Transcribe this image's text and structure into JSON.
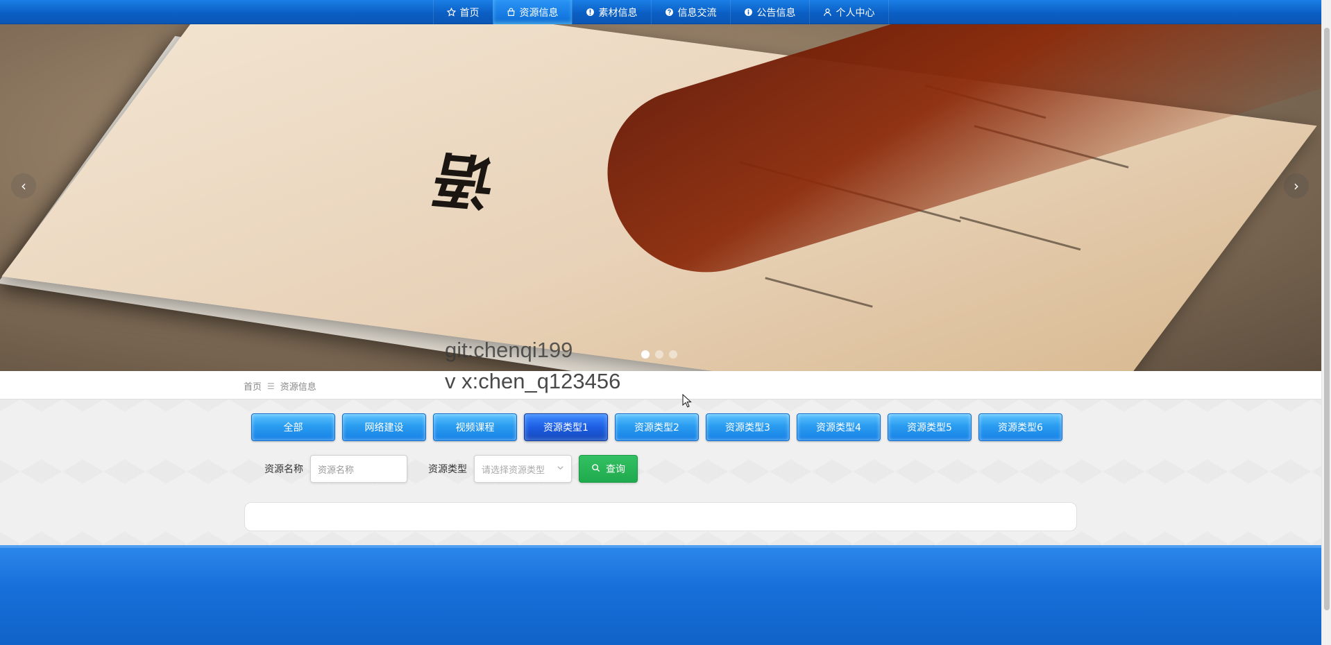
{
  "nav": {
    "items": [
      {
        "label": "首页",
        "icon": "star-icon",
        "active": false
      },
      {
        "label": "资源信息",
        "icon": "bag-icon",
        "active": true
      },
      {
        "label": "素材信息",
        "icon": "info-icon",
        "active": false
      },
      {
        "label": "信息交流",
        "icon": "question-icon",
        "active": false
      },
      {
        "label": "公告信息",
        "icon": "info-circle-icon",
        "active": false
      },
      {
        "label": "个人中心",
        "icon": "user-icon",
        "active": false
      }
    ]
  },
  "banner": {
    "prev_symbol": "‹",
    "next_symbol": "›",
    "slide_count": 3,
    "active_slide": 1,
    "image_char": "语"
  },
  "watermark": {
    "line1": "git:chenqi199",
    "line2": "v x:chen_q123456"
  },
  "breadcrumb": {
    "home": "首页",
    "separator": "☰",
    "current": "资源信息"
  },
  "categories": [
    {
      "label": "全部",
      "active": false
    },
    {
      "label": "网络建设",
      "active": false
    },
    {
      "label": "视频课程",
      "active": false
    },
    {
      "label": "资源类型1",
      "active": true
    },
    {
      "label": "资源类型2",
      "active": false
    },
    {
      "label": "资源类型3",
      "active": false
    },
    {
      "label": "资源类型4",
      "active": false
    },
    {
      "label": "资源类型5",
      "active": false
    },
    {
      "label": "资源类型6",
      "active": false
    }
  ],
  "search": {
    "name_label": "资源名称",
    "name_placeholder": "资源名称",
    "type_label": "资源类型",
    "type_placeholder": "请选择资源类型",
    "button_label": "查询"
  },
  "colors": {
    "nav_bg": "#0b5fc4",
    "category_blue": "#2a9cf0",
    "category_active": "#1d5ee3",
    "search_green": "#1faa4d",
    "footer_blue": "#1770d9"
  }
}
